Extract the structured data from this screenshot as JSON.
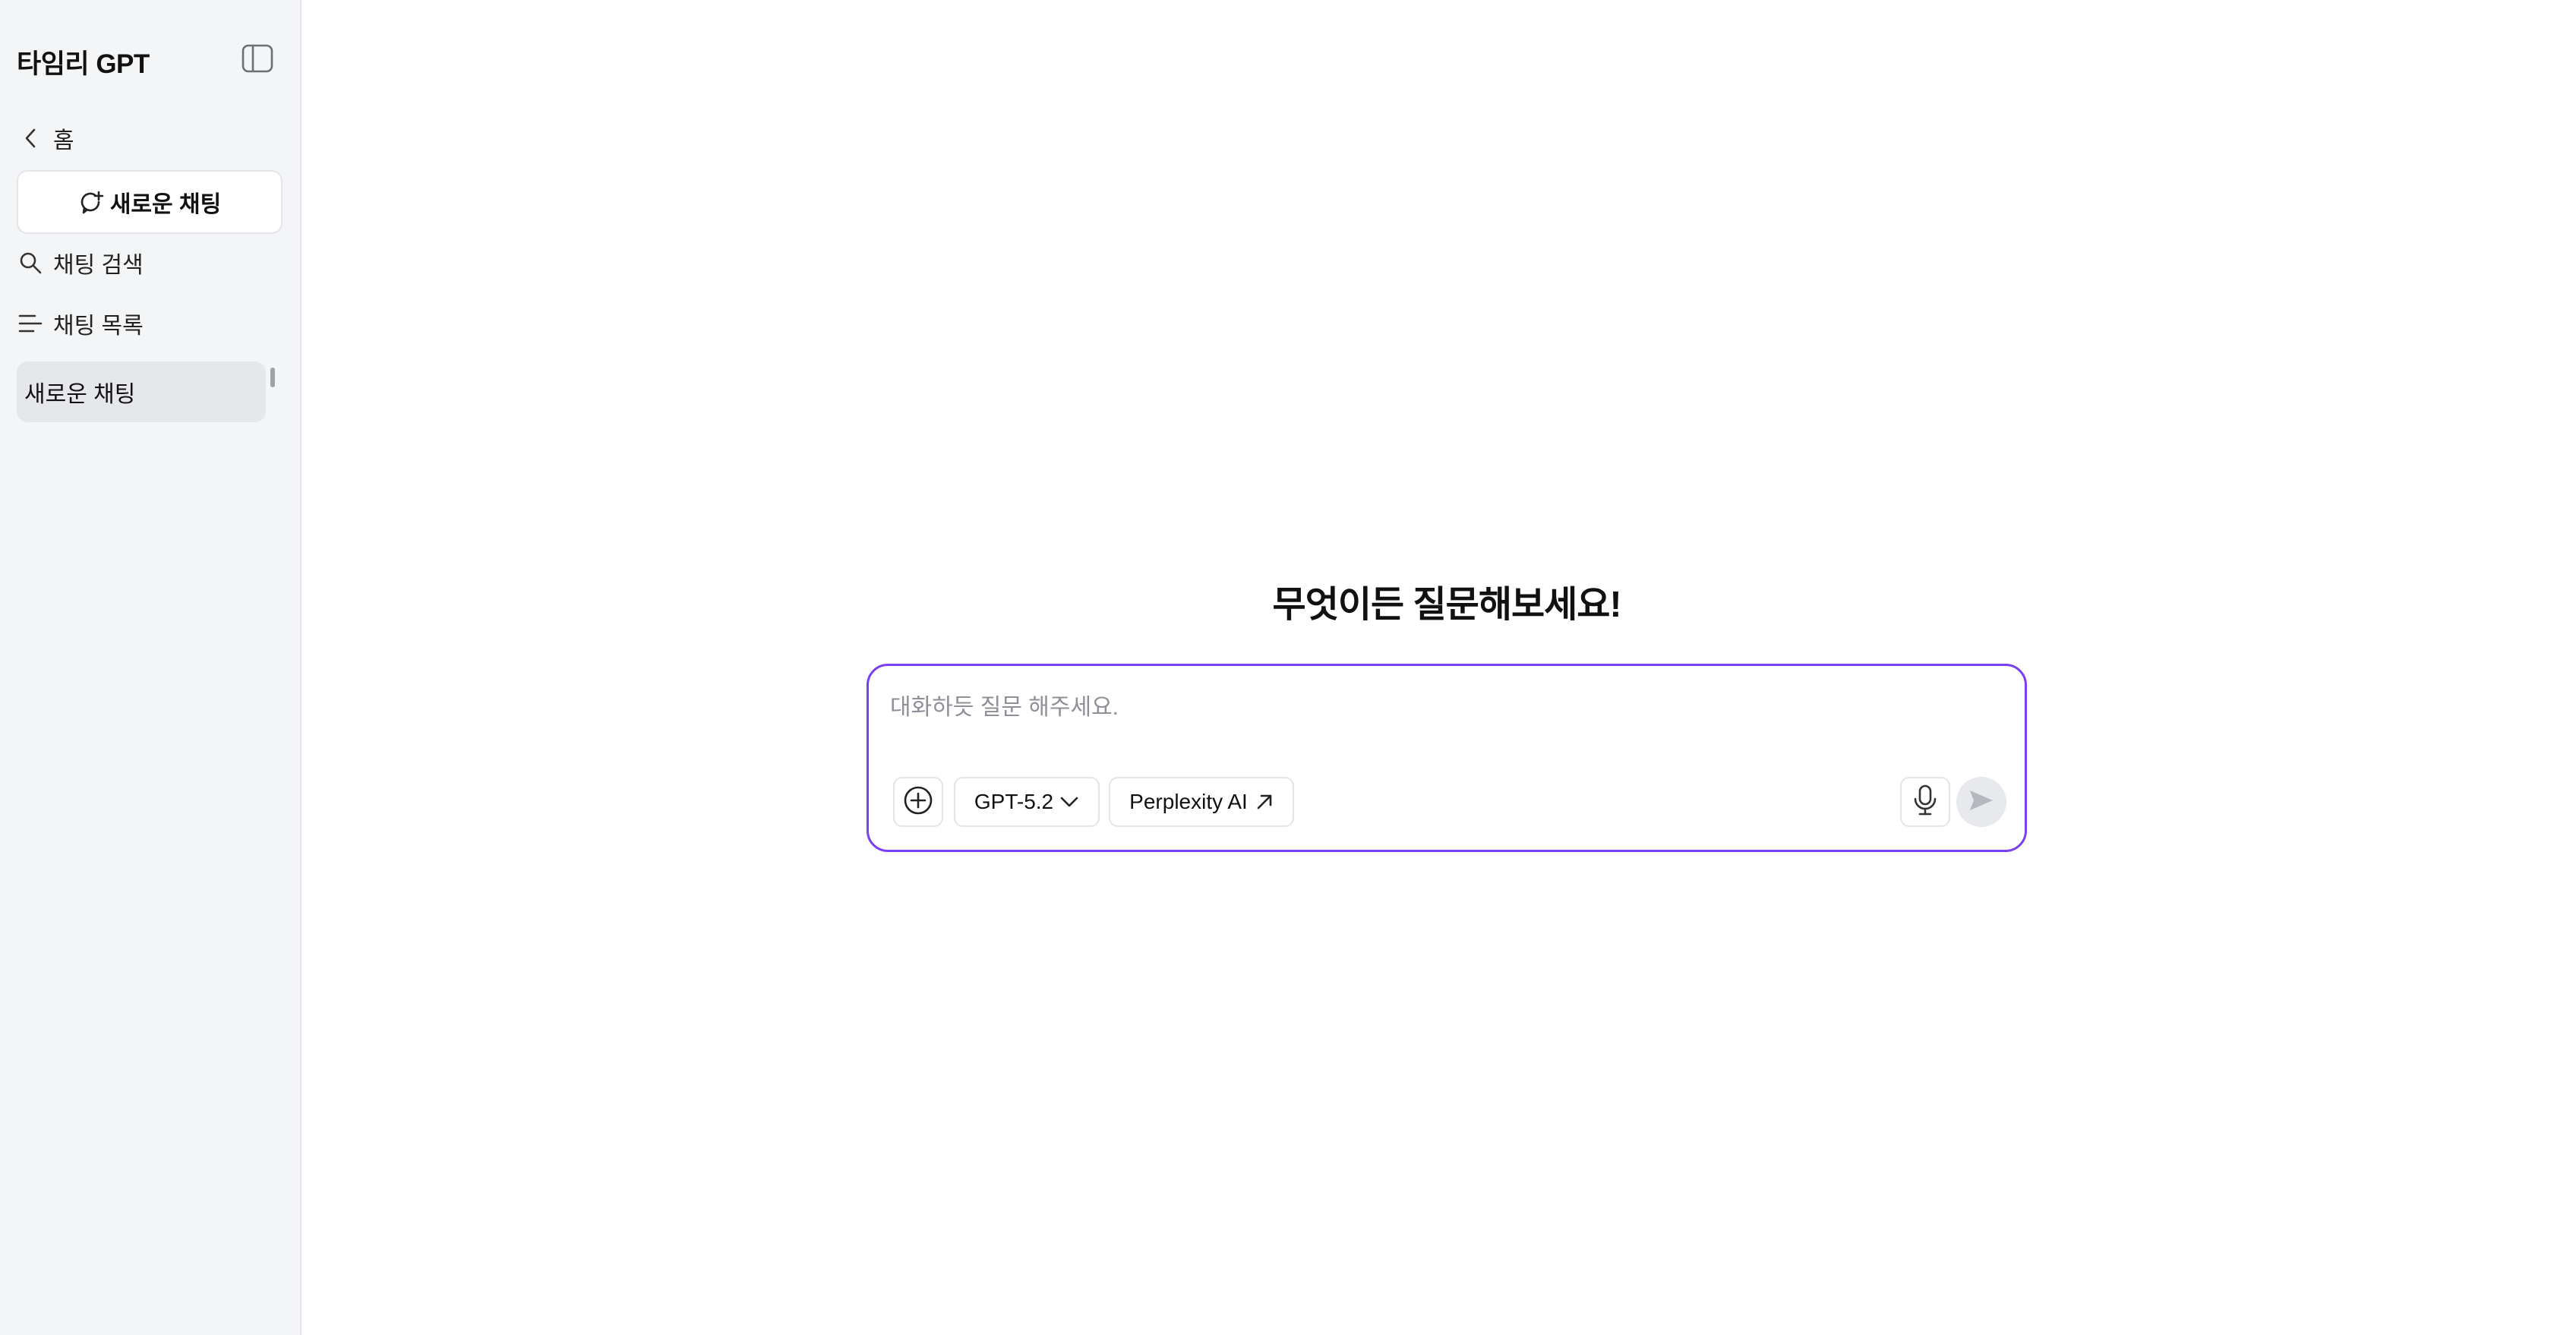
{
  "sidebar": {
    "brand": "타임리 GPT",
    "home_label": "홈",
    "new_chat_label": "새로운 채팅",
    "search_label": "채팅 검색",
    "list_label": "채팅 목록",
    "chats": [
      {
        "title": "새로운 채팅"
      }
    ]
  },
  "main": {
    "headline": "무엇이든 질문해보세요!",
    "composer": {
      "placeholder": "대화하듯 질문 해주세요.",
      "value": "",
      "model": "GPT-5.2",
      "perplexity_label": "Perplexity AI"
    }
  },
  "colors": {
    "accent": "#7b3ff2",
    "sidebar_bg": "#f4f5f6",
    "selected_item_bg": "#e5e7ea"
  },
  "icons": {
    "panel_toggle": "sidebar-toggle-icon",
    "home": "chevron-left-icon",
    "new_chat": "new-chat-icon",
    "search": "search-icon",
    "list": "list-icon",
    "attach": "plus-circle-icon",
    "model": "chevron-down-icon",
    "perplexity": "arrow-up-right-icon",
    "mic": "microphone-icon",
    "send": "send-icon"
  }
}
